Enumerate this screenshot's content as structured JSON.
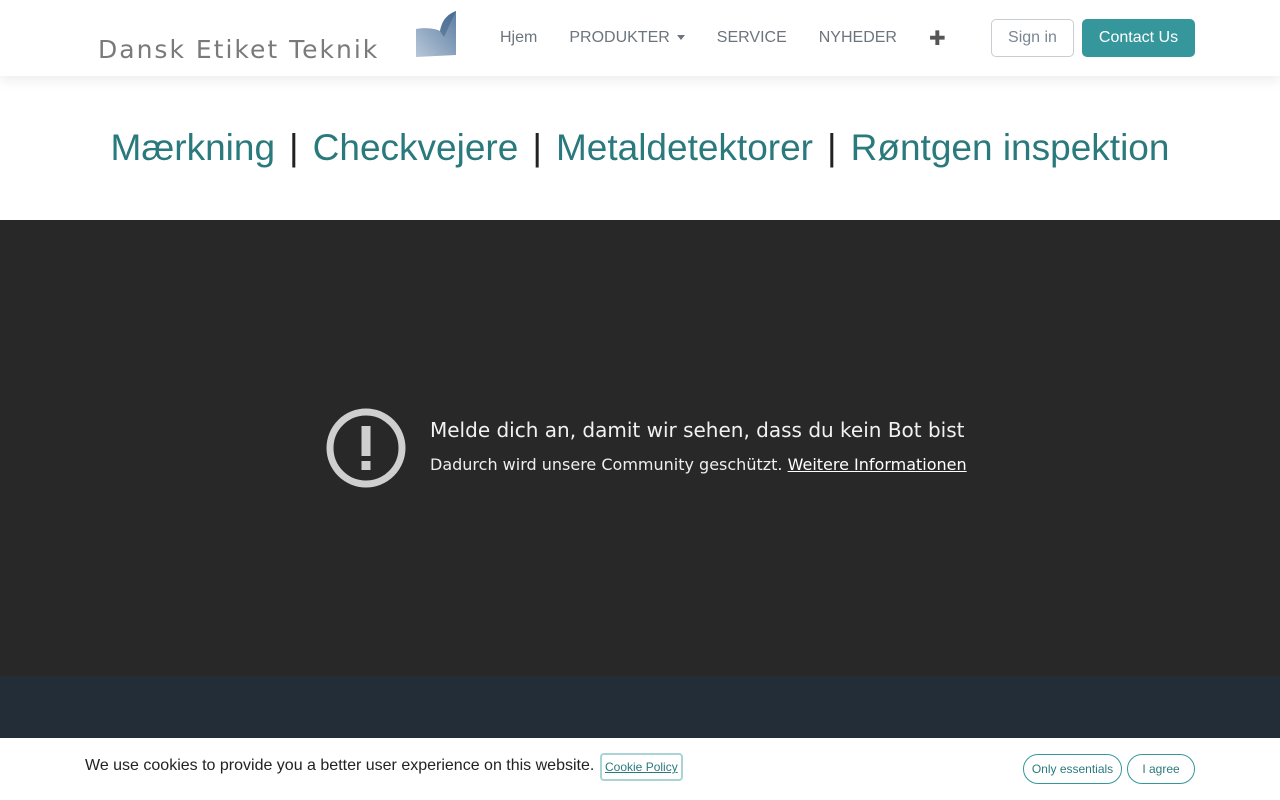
{
  "header": {
    "logo_text": "Dansk Etiket Teknik",
    "nav": {
      "home": "Hjem",
      "products": "PRODUKTER",
      "service": "SERVICE",
      "news": "NYHEDER",
      "more_icon": "plus-icon"
    },
    "sign_in": "Sign in",
    "contact": "Contact Us"
  },
  "categories": {
    "items": [
      "Mærkning",
      "Checkvejere",
      "Metaldetektorer",
      "Røntgen inspektion"
    ],
    "separator": "|"
  },
  "embed": {
    "icon": "alert-circle-icon",
    "title": "Melde dich an, damit wir sehen, dass du kein Bot bist",
    "subtitle": "Dadurch wird unsere Community geschützt.",
    "link": "Weitere Informationen"
  },
  "cookie": {
    "message": "We use cookies to provide you a better user experience on this website.",
    "policy_link": "Cookie Policy",
    "only_essentials": "Only essentials",
    "agree": "I agree"
  },
  "colors": {
    "accent": "#35979c",
    "link": "#2a7a7d",
    "embed_bg": "#282828",
    "footer_bg": "#232d37"
  }
}
